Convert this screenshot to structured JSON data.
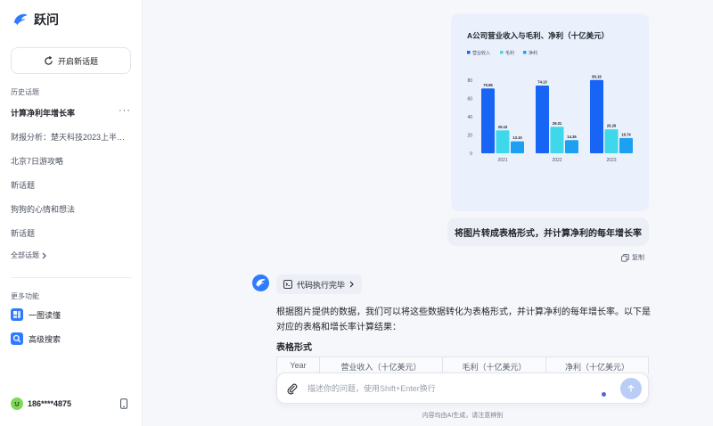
{
  "app": {
    "name": "跃问"
  },
  "sidebar": {
    "new_topic_label": "开启新话题",
    "history_label": "历史话题",
    "history": [
      {
        "label": "计算净利年增长率",
        "active": true
      },
      {
        "label": "财报分析：楚天科技2023上半年业绩"
      },
      {
        "label": "北京7日游攻略"
      },
      {
        "label": "新话题"
      },
      {
        "label": "狗狗的心情和想法"
      },
      {
        "label": "新话题"
      }
    ],
    "all_topics_label": "全部话题",
    "more_features_label": "更多功能",
    "features": [
      {
        "label": "一图读懂",
        "icon": "image-read-icon"
      },
      {
        "label": "高级搜索",
        "icon": "search-icon"
      }
    ],
    "user": {
      "name": "186****4875"
    }
  },
  "chat": {
    "user_message": "将图片转成表格形式，并计算净利的每年增长率",
    "copy_label": "复制",
    "code_status": "代码执行完毕",
    "answer_text": "根据图片提供的数据，我们可以将这些数据转化为表格形式，并计算净利的每年增长率。以下是对应的表格和增长率计算结果：",
    "answer_subtitle": "表格形式",
    "table_headers": [
      "Year",
      "营业收入（十亿美元）",
      "毛利（十亿美元）",
      "净利（十亿美元）"
    ]
  },
  "input": {
    "placeholder": "描述你的问题，使用Shift+Enter换行"
  },
  "disclaimer": "内容均由AI生成，请注意辨别",
  "chart_data": {
    "type": "bar",
    "title": "A公司营业收入与毛利、净利（十亿美元）",
    "categories": [
      "2021",
      "2022",
      "2023"
    ],
    "series": [
      {
        "name": "营业收入",
        "values": [
          70.95,
          74.13,
          80.19
        ],
        "color": "#1764f5"
      },
      {
        "name": "毛利",
        "values": [
          25.1,
          29.01,
          26.26
        ],
        "color": "#3fd8ea"
      },
      {
        "name": "净利",
        "values": [
          13.1,
          14.35,
          16.74
        ],
        "color": "#1da0f2"
      }
    ],
    "yticks": [
      0,
      20,
      40,
      60,
      80
    ],
    "ylim": [
      0,
      80
    ],
    "legend": "top-left",
    "grid": false
  }
}
